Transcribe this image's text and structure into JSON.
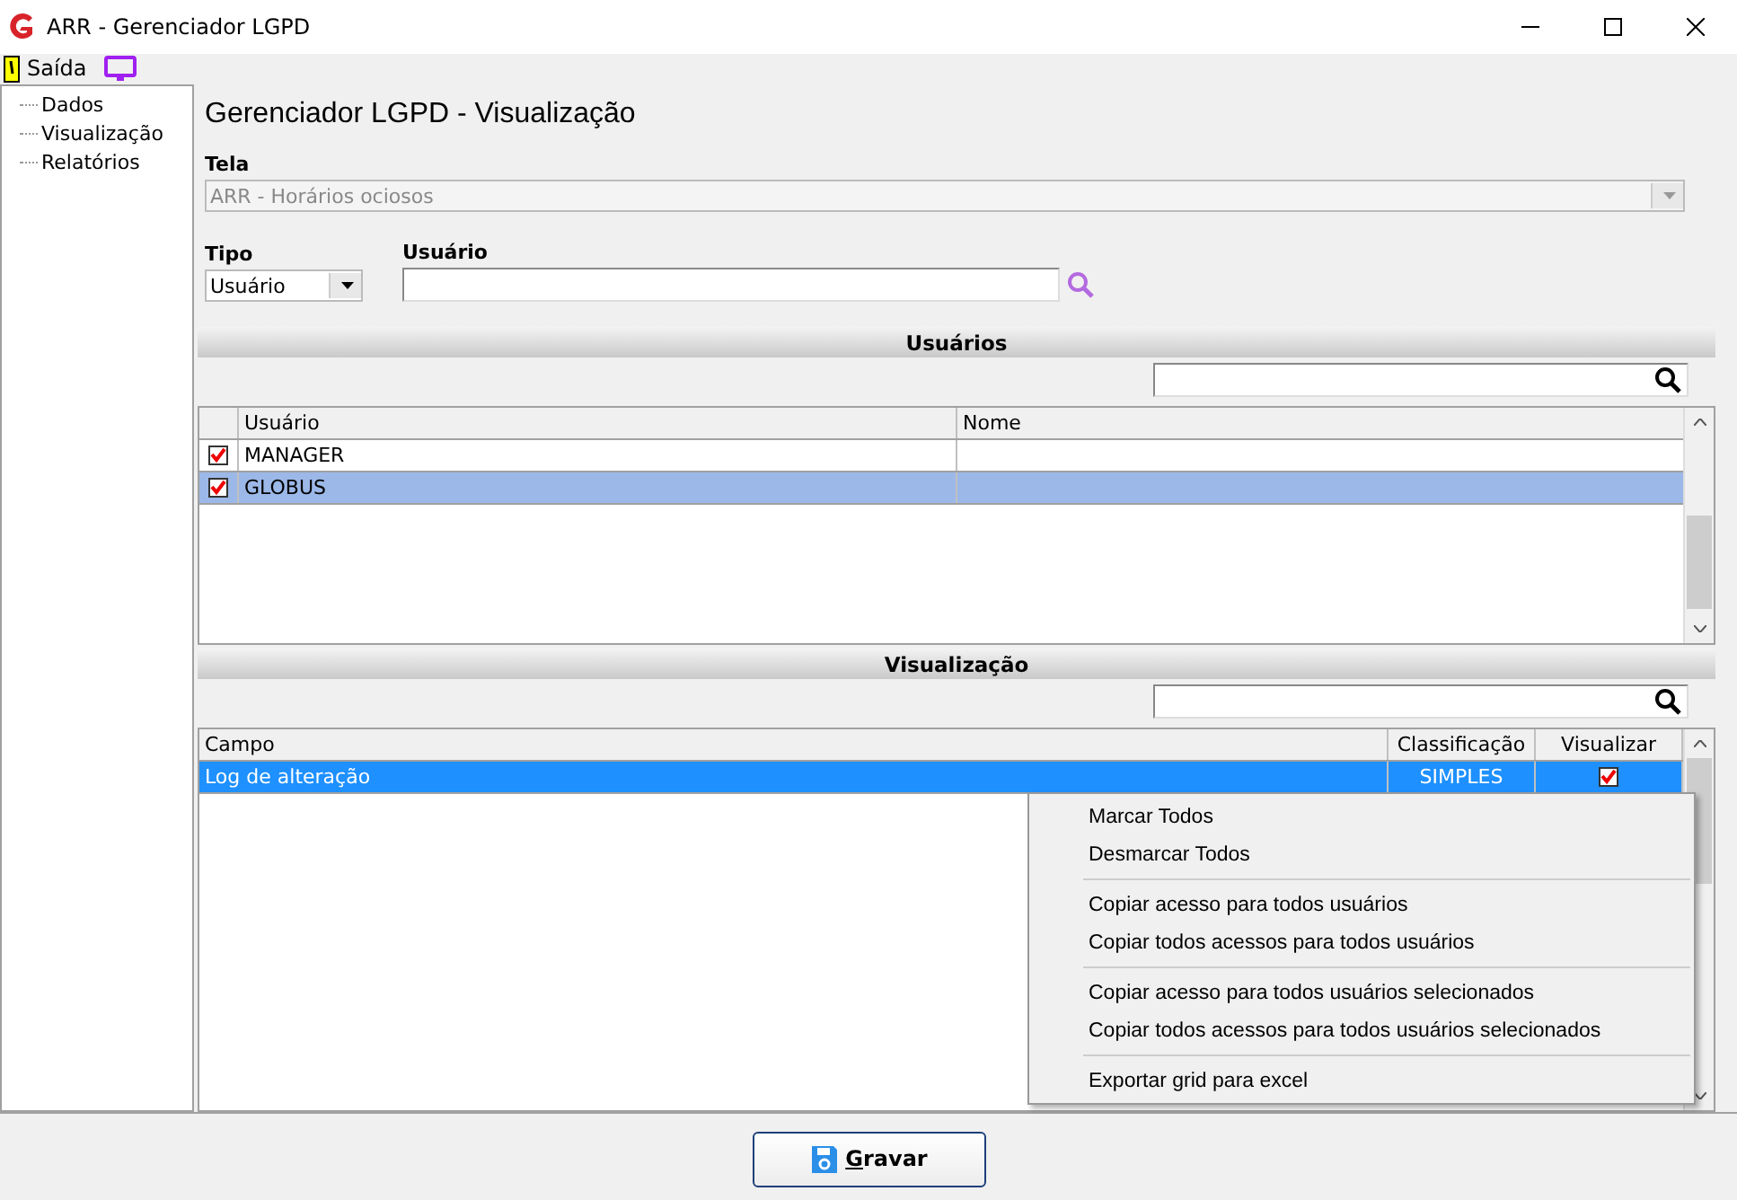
{
  "window": {
    "title": "ARR - Gerenciador LGPD"
  },
  "toolbar": {
    "exit_label": "Saída"
  },
  "sidebar": {
    "items": [
      {
        "label": "Dados",
        "selected": false
      },
      {
        "label": "Visualização",
        "selected": false
      },
      {
        "label": "Relatórios",
        "selected": false
      }
    ]
  },
  "heading": "Gerenciador LGPD - Visualização",
  "tela": {
    "label": "Tela",
    "value": "ARR - Horários ociosos",
    "disabled": true
  },
  "tipo": {
    "label": "Tipo",
    "value": "Usuário"
  },
  "usuario": {
    "label": "Usuário"
  },
  "users_section": {
    "title": "Usuários",
    "columns": [
      "Usuário",
      "Nome"
    ],
    "rows": [
      {
        "checked": true,
        "usuario": "MANAGER",
        "selected": false
      },
      {
        "checked": true,
        "usuario": "GLOBUS",
        "selected": true
      }
    ]
  },
  "view_section": {
    "title": "Visualização",
    "columns": [
      "Campo",
      "Classificação",
      "Visualizar"
    ],
    "rows": [
      {
        "campo": "Log de alteração",
        "classificacao": "SIMPLES",
        "visualizar": true,
        "selected": true
      }
    ]
  },
  "context_menu": {
    "groups": [
      [
        "Marcar Todos",
        "Desmarcar Todos"
      ],
      [
        "Copiar acesso para todos usuários",
        "Copiar todos acessos para todos usuários"
      ],
      [
        "Copiar acesso para todos usuários selecionados",
        "Copiar todos acessos para todos usuários selecionados"
      ],
      [
        "Exportar grid para excel"
      ]
    ]
  },
  "save_button": "Gravar"
}
